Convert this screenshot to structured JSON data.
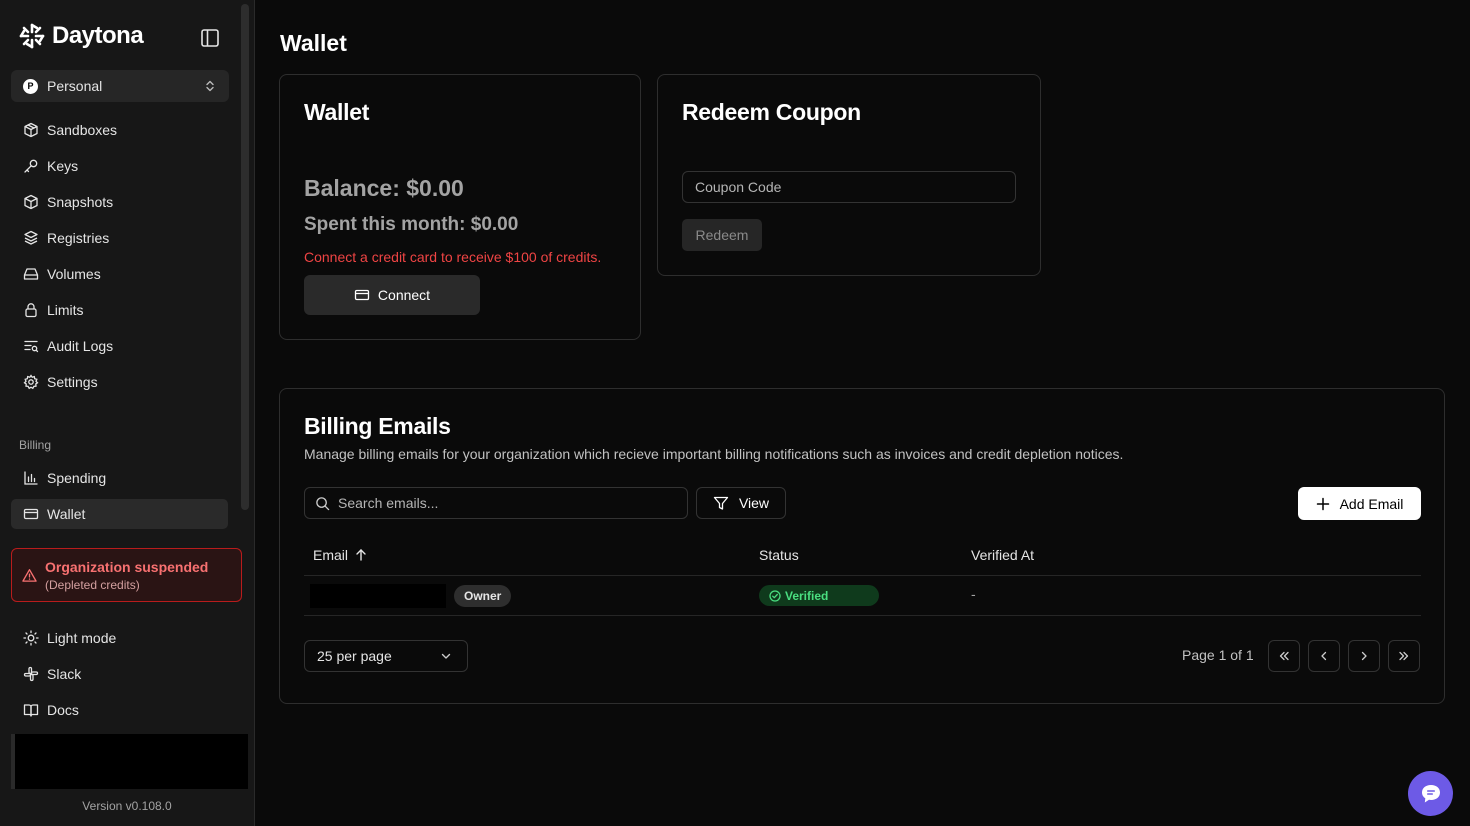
{
  "brand": {
    "name": "Daytona"
  },
  "org": {
    "initial": "P",
    "name": "Personal"
  },
  "nav": {
    "sandboxes": "Sandboxes",
    "keys": "Keys",
    "snapshots": "Snapshots",
    "registries": "Registries",
    "volumes": "Volumes",
    "limits": "Limits",
    "audit_logs": "Audit Logs",
    "settings": "Settings"
  },
  "billing_section": {
    "label": "Billing",
    "spending": "Spending",
    "wallet": "Wallet"
  },
  "alert": {
    "title": "Organization suspended",
    "subtitle": "(Depleted credits)"
  },
  "footer_nav": {
    "light_mode": "Light mode",
    "slack": "Slack",
    "docs": "Docs"
  },
  "version": "Version v0.108.0",
  "page": {
    "title": "Wallet"
  },
  "wallet_card": {
    "title": "Wallet",
    "balance": "Balance: $0.00",
    "spent": "Spent this month: $0.00",
    "promo": "Connect a credit card to receive $100 of credits.",
    "connect_label": "Connect"
  },
  "coupon_card": {
    "title": "Redeem Coupon",
    "input_placeholder": "Coupon Code",
    "redeem_label": "Redeem"
  },
  "billing_emails": {
    "title": "Billing Emails",
    "description": "Manage billing emails for your organization which recieve important billing notifications such as invoices and credit depletion notices.",
    "search_placeholder": "Search emails...",
    "view_label": "View",
    "add_label": "Add Email",
    "columns": {
      "email": "Email",
      "status": "Status",
      "verified_at": "Verified At"
    },
    "rows": [
      {
        "role": "Owner",
        "status": "Verified",
        "verified_at": "-"
      }
    ],
    "per_page": "25 per page",
    "page_info": "Page 1 of 1"
  },
  "colors": {
    "accent": "#6d5ae6",
    "danger": "#ef4444",
    "success": "#4ade80"
  }
}
